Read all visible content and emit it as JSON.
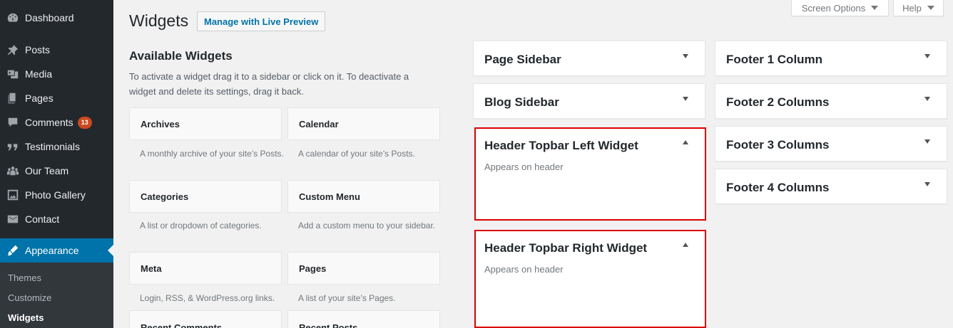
{
  "menu": {
    "items": [
      {
        "label": "Dashboard",
        "icon": "dashboard-icon"
      },
      {
        "label": "Posts",
        "icon": "pin-icon"
      },
      {
        "label": "Media",
        "icon": "media-icon"
      },
      {
        "label": "Pages",
        "icon": "pages-icon"
      },
      {
        "label": "Comments",
        "icon": "comment-icon",
        "badge": "13"
      },
      {
        "label": "Testimonials",
        "icon": "quote-icon"
      },
      {
        "label": "Our Team",
        "icon": "groups-icon"
      },
      {
        "label": "Photo Gallery",
        "icon": "gallery-icon"
      },
      {
        "label": "Contact",
        "icon": "email-icon"
      },
      {
        "label": "Appearance",
        "icon": "brush-icon"
      }
    ],
    "submenu": [
      "Themes",
      "Customize",
      "Widgets"
    ]
  },
  "top_tabs": {
    "screen_options": "Screen Options",
    "help": "Help"
  },
  "header": {
    "title": "Widgets",
    "action": "Manage with Live Preview"
  },
  "available": {
    "title": "Available Widgets",
    "description": "To activate a widget drag it to a sidebar or click on it. To deactivate a widget and delete its settings, drag it back.",
    "widgets": [
      {
        "name": "Archives",
        "desc": "A monthly archive of your site’s Posts."
      },
      {
        "name": "Calendar",
        "desc": "A calendar of your site’s Posts."
      },
      {
        "name": "Categories",
        "desc": "A list or dropdown of categories."
      },
      {
        "name": "Custom Menu",
        "desc": "Add a custom menu to your sidebar."
      },
      {
        "name": "Meta",
        "desc": "Login, RSS, & WordPress.org links."
      },
      {
        "name": "Pages",
        "desc": "A list of your site’s Pages."
      },
      {
        "name": "Recent Comments",
        "desc": ""
      },
      {
        "name": "Recent Posts",
        "desc": ""
      }
    ]
  },
  "sidebars": [
    {
      "name": "Page Sidebar",
      "desc": ""
    },
    {
      "name": "Blog Sidebar",
      "desc": ""
    },
    {
      "name": "Header Topbar Left Widget",
      "desc": "Appears on header"
    },
    {
      "name": "Header Topbar Right Widget",
      "desc": "Appears on header"
    },
    {
      "name": "Footer 1 Column",
      "desc": ""
    },
    {
      "name": "Footer 2 Columns",
      "desc": ""
    },
    {
      "name": "Footer 3 Columns",
      "desc": ""
    },
    {
      "name": "Footer 4 Columns",
      "desc": ""
    }
  ],
  "colors": {
    "sidebar_bg": "#23282d",
    "accent": "#0073aa",
    "highlight": "#dd0000",
    "badge": "#ca4a1f"
  }
}
